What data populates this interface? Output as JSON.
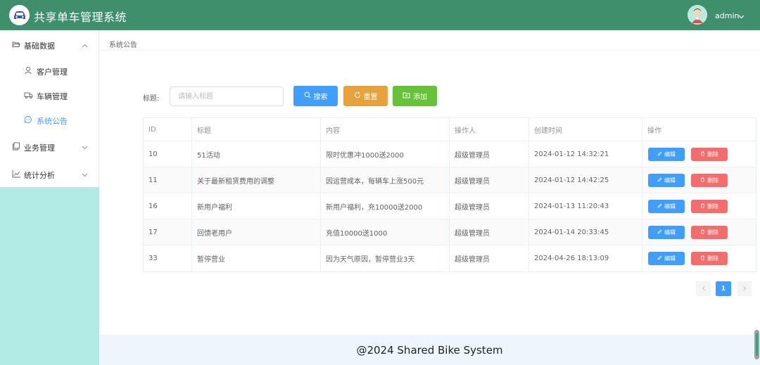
{
  "header": {
    "title": "共享单车管理系统",
    "user": "admin",
    "logo_icon": "car-icon",
    "bg_color": "#3f8e6c"
  },
  "sidebar": {
    "groups": [
      {
        "label": "基础数据",
        "icon": "folder-open-icon",
        "expanded": true,
        "items": [
          {
            "label": "客户管理",
            "icon": "user-icon"
          },
          {
            "label": "车辆管理",
            "icon": "truck-icon"
          },
          {
            "label": "系统公告",
            "icon": "chat-icon",
            "active": true
          }
        ]
      },
      {
        "label": "业务管理",
        "icon": "copy-icon",
        "expanded": false
      },
      {
        "label": "统计分析",
        "icon": "chart-icon",
        "expanded": false
      }
    ]
  },
  "breadcrumb": "系统公告",
  "search": {
    "label": "标题:",
    "placeholder": "请输入标题",
    "search_label": "搜索",
    "reset_label": "重置",
    "add_label": "添加"
  },
  "table": {
    "columns": [
      "ID",
      "标题",
      "内容",
      "操作人",
      "创建时间",
      "操作"
    ],
    "edit_label": "编辑",
    "delete_label": "删除",
    "rows": [
      {
        "id": "10",
        "title": "51活动",
        "content": "限时优惠冲1000送2000",
        "operator": "超级管理员",
        "created": "2024-01-12 14:32:21"
      },
      {
        "id": "11",
        "title": "关于最新租赁费用的调整",
        "content": "因运营成本，每辆车上涨500元",
        "operator": "超级管理员",
        "created": "2024-01-12 14:42:25"
      },
      {
        "id": "16",
        "title": "新用户福利",
        "content": "新用户福利，充10000送2000",
        "operator": "超级管理员",
        "created": "2024-01-13 11:20:43"
      },
      {
        "id": "17",
        "title": "回馈老用户",
        "content": "充值10000送1000",
        "operator": "超级管理员",
        "created": "2024-01-14 20:33:45"
      },
      {
        "id": "33",
        "title": "暂停营业",
        "content": "因为天气原因，暂停营业3天",
        "operator": "超级管理员",
        "created": "2024-04-26 18:13:09"
      }
    ]
  },
  "pagination": {
    "current_page": "1"
  },
  "footer": "@2024 Shared Bike System"
}
